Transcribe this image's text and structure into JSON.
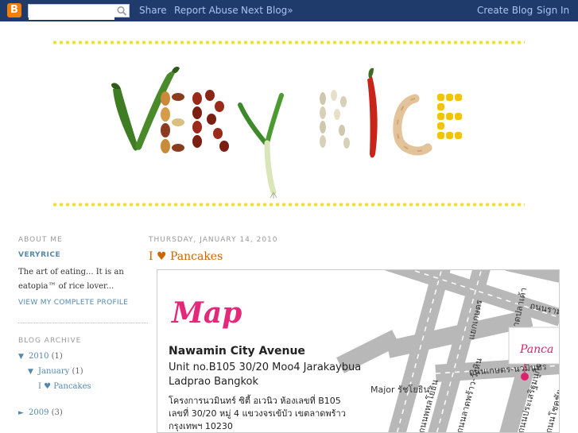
{
  "navbar": {
    "logo_letter": "B",
    "search_placeholder": "",
    "share": "Share",
    "report_abuse": "Report Abuse",
    "next_blog": "Next Blog»",
    "create_blog": "Create Blog",
    "sign_in": "Sign In"
  },
  "header": {
    "title_left": "VERY",
    "title_right": "RICE"
  },
  "sidebar": {
    "about_heading": "ABOUT ME",
    "profile_name": "VERYRICE",
    "description": "The art of eating... It is an eatopia™ of rice lover...",
    "profile_link": "VIEW MY COMPLETE PROFILE",
    "archive_heading": "BLOG ARCHIVE",
    "archive": [
      {
        "toggle": "▼",
        "label": "2010",
        "count": "(1)"
      },
      {
        "toggle": "▼",
        "label": "January",
        "count": "(1)"
      },
      {
        "toggle": "",
        "label": "I ♥ Pancakes",
        "count": ""
      },
      {
        "toggle": "►",
        "label": "2009",
        "count": "(3)"
      }
    ]
  },
  "post": {
    "date": "THURSDAY, JANUARY 14, 2010",
    "title": "I ♥ Pancakes",
    "map": {
      "heading": "Map",
      "place": "Nawamin City Avenue",
      "unit": "Unit no.B105 30/20 Moo4 Jarakaybua",
      "area": "Ladprao Bangkok",
      "thai_1": "โครงการนวมินทร์ ซิตี้ อเวนิว ห้องเลขที่ B105",
      "thai_2": "เลขที่ 30/20 หมู่ 4 แขวงจรเข้บัว เขตลาดพร้าว",
      "thai_3": "กรุงเทพฯ 10230",
      "road_1": "ถนนรามอินทรา",
      "road_2": "แยกเกษตร",
      "road_3": "ถนนลาดปลาเค้า",
      "road_4": "ถนนเกษตร-นวมินทร์",
      "road_5": "ถนนพหลโยธิน",
      "road_6": "ถนนลาดพร้าว-วังหิน",
      "road_7": "ถนนประเสริฐมนูกิจ",
      "road_8": "ถนนโชคชัย",
      "road_9": "ถนนนวมินทร์",
      "landmark": "Major รัชโยธิน",
      "pin_label": "Panca"
    }
  }
}
